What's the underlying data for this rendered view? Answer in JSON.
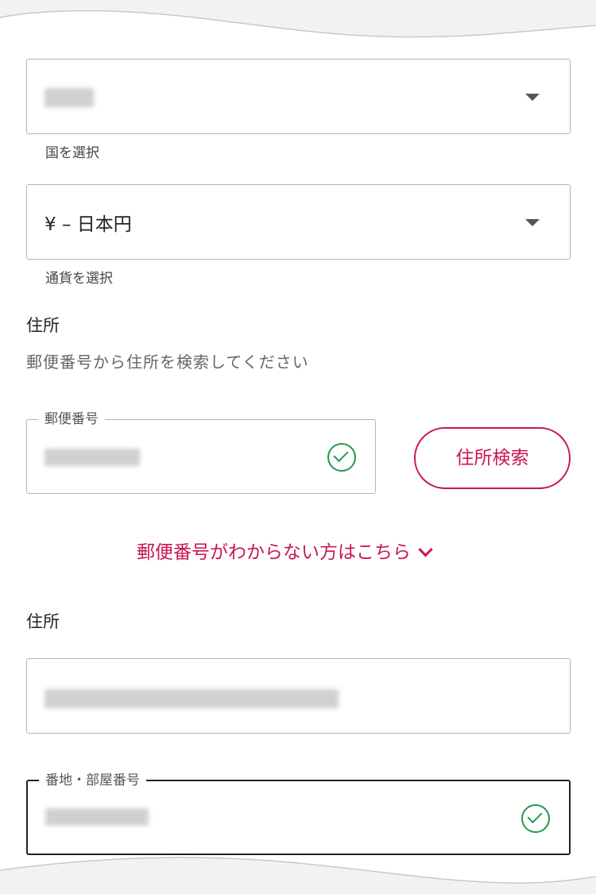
{
  "country_select": {
    "value": "███",
    "helper": "国を選択"
  },
  "currency_select": {
    "value": "¥ – 日本円",
    "helper": "通貨を選択"
  },
  "address_section": {
    "title": "住所",
    "description": "郵便番号から住所を検索してください"
  },
  "postal_code": {
    "label": "郵便番号",
    "value": "███-████"
  },
  "search_button": {
    "label": "住所検索"
  },
  "unknown_postal_link": {
    "label": "郵便番号がわからない方はこちら"
  },
  "address_field": {
    "title": "住所",
    "value": "████████████████"
  },
  "street_field": {
    "label": "番地・部屋番号",
    "value": "█-█-███ ██"
  },
  "colors": {
    "accent": "#c8174f",
    "success": "#1e9a4b",
    "border": "#b5b5b5"
  }
}
